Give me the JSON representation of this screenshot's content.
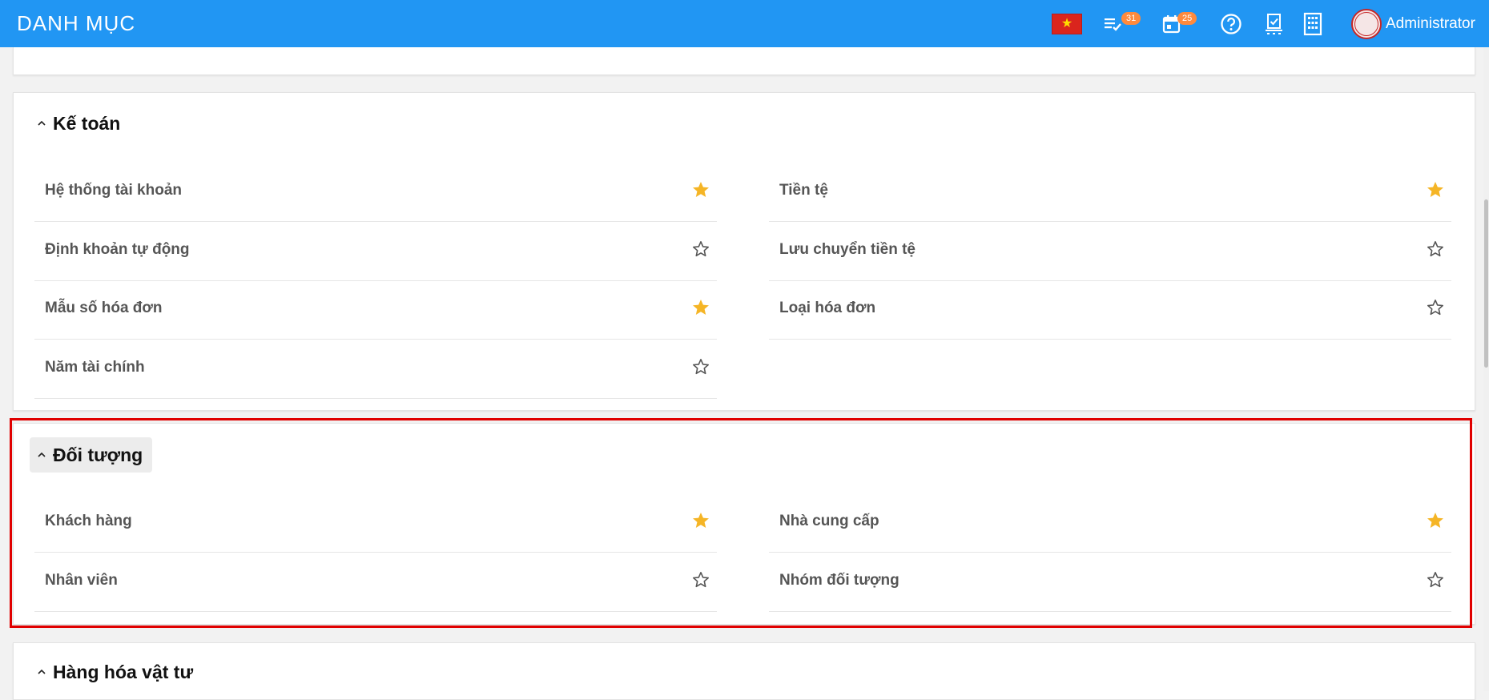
{
  "header": {
    "title": "DANH MỤC",
    "tasks_badge": "31",
    "calendar_badge": "25",
    "user_name": "Administrator"
  },
  "icons": {
    "flag": "vietnam-flag-icon",
    "tasks": "task-list-icon",
    "calendar": "calendar-icon",
    "help": "help-icon",
    "approval": "approval-icon",
    "company": "building-icon",
    "avatar": "stamp-avatar-icon"
  },
  "colors": {
    "topbar": "#2196f3",
    "star_active": "#f5b526",
    "star_inactive": "#555555",
    "badge": "#ff8a3d",
    "highlight": "#e00000"
  },
  "sections": {
    "accounting": {
      "title": "Kế toán",
      "items": [
        {
          "label": "Hệ thống tài khoản",
          "starred": true
        },
        {
          "label": "Tiền tệ",
          "starred": true
        },
        {
          "label": "Định khoản tự động",
          "starred": false
        },
        {
          "label": "Lưu chuyển tiền tệ",
          "starred": false
        },
        {
          "label": "Mẫu số hóa đơn",
          "starred": true
        },
        {
          "label": "Loại hóa đơn",
          "starred": false
        },
        {
          "label": "Năm tài chính",
          "starred": false
        }
      ]
    },
    "objects": {
      "title": "Đối tượng",
      "items": [
        {
          "label": "Khách hàng",
          "starred": true
        },
        {
          "label": "Nhà cung cấp",
          "starred": true
        },
        {
          "label": "Nhân viên",
          "starred": false
        },
        {
          "label": "Nhóm đối tượng",
          "starred": false
        }
      ]
    },
    "goods": {
      "title": "Hàng hóa vật tư"
    }
  }
}
